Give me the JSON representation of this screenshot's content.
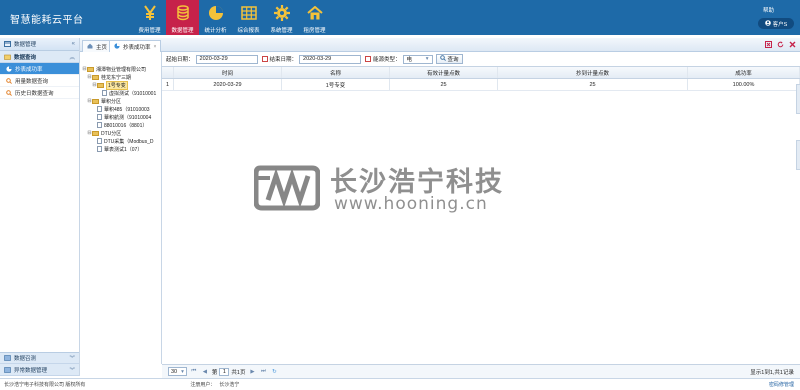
{
  "app": {
    "title": "智慧能耗云平台",
    "help": "帮助",
    "user": "客户S"
  },
  "nav": [
    {
      "label": "费用管理",
      "icon": "yen-icon"
    },
    {
      "label": "数据管理",
      "icon": "database-icon",
      "active": true
    },
    {
      "label": "统计分析",
      "icon": "pie-chart-icon"
    },
    {
      "label": "综合报表",
      "icon": "grid-table-icon"
    },
    {
      "label": "系统管理",
      "icon": "gear-icon"
    },
    {
      "label": "租房管理",
      "icon": "house-icon"
    }
  ],
  "sidebar": {
    "header": "数据管理",
    "section": "数据查询",
    "items": [
      {
        "label": "抄表成功率",
        "active": true
      },
      {
        "label": "用量数据查询"
      },
      {
        "label": "历史日数据查询"
      }
    ],
    "bottom": [
      {
        "label": "数据召测"
      },
      {
        "label": "异常数据管理"
      }
    ]
  },
  "tabs": [
    {
      "label": "主页"
    },
    {
      "label": "抄表成功率",
      "close": "×"
    }
  ],
  "tree": [
    {
      "label": "湘潭物业管理有限公司",
      "level": 0,
      "type": "folder",
      "toggle": "⊟"
    },
    {
      "label": "桂龙东宁三期",
      "level": 1,
      "type": "folder",
      "toggle": "⊟"
    },
    {
      "label": "1号专变",
      "level": 2,
      "type": "folder",
      "toggle": "⊟",
      "selected": true
    },
    {
      "label": "虚拟测试（91010001",
      "level": 3,
      "type": "file"
    },
    {
      "label": "蕈积分区",
      "level": 1,
      "type": "folder",
      "toggle": "⊟"
    },
    {
      "label": "蕈积485（91010003",
      "level": 2,
      "type": "file"
    },
    {
      "label": "蕈积航测（91010004",
      "level": 2,
      "type": "file"
    },
    {
      "label": "88010016（8801）",
      "level": 2,
      "type": "file"
    },
    {
      "label": "DTU分区",
      "level": 1,
      "type": "folder",
      "toggle": "⊟"
    },
    {
      "label": "DTU采集（Modbus_D",
      "level": 2,
      "type": "file"
    },
    {
      "label": "蕈表测试1（07）",
      "level": 2,
      "type": "file"
    }
  ],
  "toolbar": {
    "start_label": "起始日期：",
    "start_value": "2020-03-29",
    "end_label": "结束日期：",
    "end_value": "2020-03-29",
    "type_label": "能源类型：",
    "type_value": "电",
    "query": "查询"
  },
  "grid": {
    "headers": [
      "时间",
      "名称",
      "有效计量点数",
      "抄到计量点数",
      "成功率"
    ],
    "rows": [
      {
        "index": "1",
        "cells": [
          "2020-03-29",
          "1号专变",
          "25",
          "25",
          "100.00%"
        ]
      }
    ]
  },
  "watermark": {
    "cn": "长沙浩宁科技",
    "url": "www.hooning.cn"
  },
  "pager": {
    "size": "30",
    "page": "1",
    "page_prefix": "第",
    "page_suffix": "共1页",
    "info": "显示1到1,共1记录"
  },
  "footer": {
    "company": "长沙浩宁电子科技有限公司 版权所有",
    "login_label": "注册用户：",
    "login_user": "长沙浩宁",
    "link": "密码修管理"
  }
}
